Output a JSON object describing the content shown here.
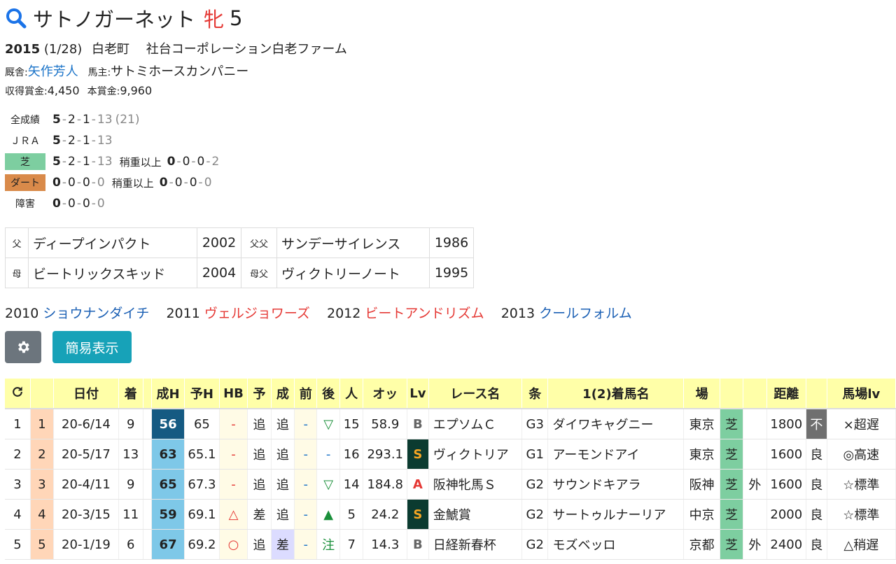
{
  "horse": {
    "name": "サトノガーネット",
    "sex": "牝",
    "age": "5",
    "birth_year": "2015",
    "birth_date": "(1/28)",
    "area": "白老町",
    "breeder": "社台コーポレーション白老ファーム",
    "trainer_label": "厩舎:",
    "trainer": "矢作芳人",
    "owner_label": "馬主:",
    "owner": "サトミホースカンパニー",
    "earn_label": "収得賞金:",
    "earn": "4,450",
    "prize_label": "本賞金:",
    "prize": "9,960"
  },
  "records": {
    "all": {
      "label": "全成績",
      "a": "5",
      "b": "2",
      "c": "1",
      "d": "13",
      "total": "(21)"
    },
    "jra": {
      "label": "ＪＲＡ",
      "a": "5",
      "b": "2",
      "c": "1",
      "d": "13"
    },
    "turf": {
      "label": "芝",
      "a": "5",
      "b": "2",
      "c": "1",
      "d": "13",
      "heavy_label": "稍重以上",
      "ha": "0",
      "hb": "0",
      "hc": "0",
      "hd": "2"
    },
    "dirt": {
      "label": "ダート",
      "a": "0",
      "b": "0",
      "c": "0",
      "d": "0",
      "heavy_label": "稍重以上",
      "ha": "0",
      "hb": "0",
      "hc": "0",
      "hd": "0"
    },
    "jump": {
      "label": "障害",
      "a": "0",
      "b": "0",
      "c": "0",
      "d": "0"
    }
  },
  "pedigree": {
    "sire_label": "父",
    "sire": "ディープインパクト",
    "sire_year": "2002",
    "ss_label": "父父",
    "ss": "サンデーサイレンス",
    "ss_year": "1986",
    "dam_label": "母",
    "dam": "ビートリックスキッド",
    "dam_year": "2004",
    "ds_label": "母父",
    "ds": "ヴィクトリーノート",
    "ds_year": "1995"
  },
  "siblings": [
    {
      "year": "2010",
      "name": "ショウナンダイチ"
    },
    {
      "year": "2011",
      "name": "ヴェルジョワーズ"
    },
    {
      "year": "2012",
      "name": "ビートアンドリズム"
    },
    {
      "year": "2013",
      "name": "クールフォルム"
    }
  ],
  "buttons": {
    "gear_icon": "gear-icon",
    "simple": "簡易表示"
  },
  "table": {
    "headers": [
      "",
      "",
      "日付",
      "着",
      "",
      "成H",
      "予H",
      "HB",
      "予",
      "成",
      "前",
      "後",
      "人",
      "オッ",
      "Lv",
      "レース名",
      "条",
      "1(2)着馬名",
      "場",
      "",
      "",
      "距離",
      "",
      "馬場lv"
    ],
    "rows": [
      {
        "no": "1",
        "n2": "1",
        "date": "20-6/14",
        "rank": "9",
        "h": "56",
        "yh": "65",
        "hb": "-",
        "yo": "追",
        "sei": "追",
        "mae": "-",
        "ato": "▽",
        "pop": "15",
        "odds": "58.9",
        "lv": "B",
        "race": "エプソムＣ",
        "grade": "G3",
        "winner": "ダイワキャグニー",
        "place": "東京",
        "surf": "芝",
        "side": "",
        "dist": "1800",
        "cond": "不",
        "blv": "×超遅"
      },
      {
        "no": "2",
        "n2": "2",
        "date": "20-5/17",
        "rank": "13",
        "h": "63",
        "yh": "65.1",
        "hb": "-",
        "yo": "追",
        "sei": "追",
        "mae": "-",
        "ato": "-",
        "pop": "16",
        "odds": "293.1",
        "lv": "S",
        "race": "ヴィクトリア",
        "grade": "G1",
        "winner": "アーモンドアイ",
        "place": "東京",
        "surf": "芝",
        "side": "",
        "dist": "1600",
        "cond": "良",
        "blv": "◎高速"
      },
      {
        "no": "3",
        "n2": "3",
        "date": "20-4/11",
        "rank": "9",
        "h": "65",
        "yh": "67.3",
        "hb": "-",
        "yo": "追",
        "sei": "追",
        "mae": "-",
        "ato": "▽",
        "pop": "14",
        "odds": "184.8",
        "lv": "A",
        "race": "阪神牝馬Ｓ",
        "grade": "G2",
        "winner": "サウンドキアラ",
        "place": "阪神",
        "surf": "芝",
        "side": "外",
        "dist": "1600",
        "cond": "良",
        "blv": "☆標準"
      },
      {
        "no": "4",
        "n2": "4",
        "date": "20-3/15",
        "rank": "11",
        "h": "59",
        "yh": "69.1",
        "hb": "△",
        "yo": "差",
        "sei": "追",
        "mae": "-",
        "ato": "▲",
        "pop": "5",
        "odds": "24.2",
        "lv": "S",
        "race": "金鯱賞",
        "grade": "G2",
        "winner": "サートゥルナーリア",
        "place": "中京",
        "surf": "芝",
        "side": "",
        "dist": "2000",
        "cond": "良",
        "blv": "☆標準"
      },
      {
        "no": "5",
        "n2": "5",
        "date": "20-1/19",
        "rank": "6",
        "h": "67",
        "yh": "69.2",
        "hb": "○",
        "yo": "追",
        "sei": "差",
        "mae": "-",
        "ato": "注",
        "pop": "7",
        "odds": "14.3",
        "lv": "B",
        "race": "日経新春杯",
        "grade": "G2",
        "winner": "モズベッロ",
        "place": "京都",
        "surf": "芝",
        "side": "外",
        "dist": "2400",
        "cond": "良",
        "blv": "△稍遅"
      }
    ]
  }
}
